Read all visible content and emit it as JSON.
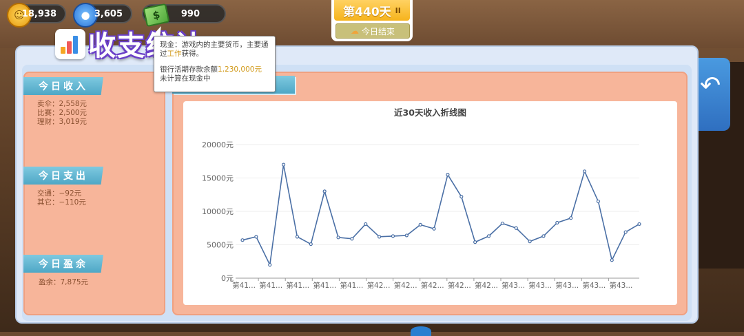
{
  "resources": {
    "gold": {
      "value": "18,938",
      "icon": "coin-icon"
    },
    "fans": {
      "value": "3,605",
      "icon": "fan-icon"
    },
    "cash": {
      "value": "990",
      "icon": "cash-icon"
    }
  },
  "day_badge": {
    "day_label": "第440天",
    "pause": "II",
    "end_day_button": "今日结束"
  },
  "panel": {
    "title": "收支统计"
  },
  "tooltip": {
    "line1_pre": "现金：游戏内的主要货币，主要通过",
    "line1_hl": "工作",
    "line1_post": "获得。",
    "line2_pre": "银行活期存款余额",
    "line2_hl": "1,230,000元",
    "line2_post": "未计算在现金中"
  },
  "income": {
    "header": "今日收入",
    "items": [
      "卖伞：2,558元",
      "比赛：2,500元",
      "理财：3,019元"
    ]
  },
  "expense": {
    "header": "今日支出",
    "items": [
      "交通：−92元",
      "其它：−110元"
    ]
  },
  "profit": {
    "header": "今日盈余",
    "items": [
      "盈余：7,875元"
    ]
  },
  "colors": {
    "line": "#4a6fa5",
    "header_blue": "#4ea7c6",
    "panel_orange": "#f7b59a",
    "title_outline": "#6a3fc8"
  },
  "chart_data": {
    "type": "line",
    "title": "近30天收入折线图",
    "ylim": [
      0,
      20000
    ],
    "y_ticks": [
      "0元",
      "5000元",
      "10000元",
      "15000元",
      "20000元"
    ],
    "x_tick_labels": [
      "第41...",
      "第41...",
      "第41...",
      "第41...",
      "第41...",
      "第42...",
      "第42...",
      "第42...",
      "第42...",
      "第42...",
      "第43...",
      "第43...",
      "第43...",
      "第43...",
      "第43..."
    ],
    "values": [
      5700,
      6200,
      2000,
      17000,
      6200,
      5100,
      13000,
      6100,
      5900,
      8100,
      6200,
      6300,
      6400,
      8000,
      7400,
      15500,
      12200,
      5400,
      6300,
      8200,
      7500,
      5500,
      6300,
      8300,
      9000,
      16000,
      11500,
      2700,
      6900,
      8100
    ],
    "grid": true
  }
}
